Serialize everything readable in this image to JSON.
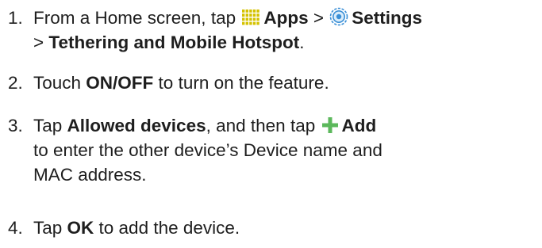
{
  "steps": [
    {
      "number": "1.",
      "line1_prefix": "From a Home screen, tap",
      "apps_icon": "apps-grid-icon",
      "apps_label": "Apps",
      "sep1": " > ",
      "settings_icon": "settings-gear-icon",
      "settings_label": "Settings",
      "line2_sep": "> ",
      "line2_bold": "Tethering and Mobile Hotspot",
      "line2_end": "."
    },
    {
      "number": "2.",
      "prefix": "Touch ",
      "bold": "ON/OFF",
      "suffix": " to turn on the feature."
    },
    {
      "number": "3.",
      "prefix": "Tap ",
      "bold1": "Allowed devices",
      "middle": ", and then tap",
      "add_icon": "plus-icon",
      "bold2": "Add",
      "line2": "to enter the other device’s Device name and",
      "line3": "MAC address."
    },
    {
      "number": "4.",
      "prefix": "Tap ",
      "bold": "OK",
      "suffix": " to add the device."
    }
  ],
  "colors": {
    "text": "#1e1e1e",
    "apps_icon": "#d4c200",
    "settings_icon": "#3a8fd6",
    "plus_icon": "#5cb85c"
  }
}
